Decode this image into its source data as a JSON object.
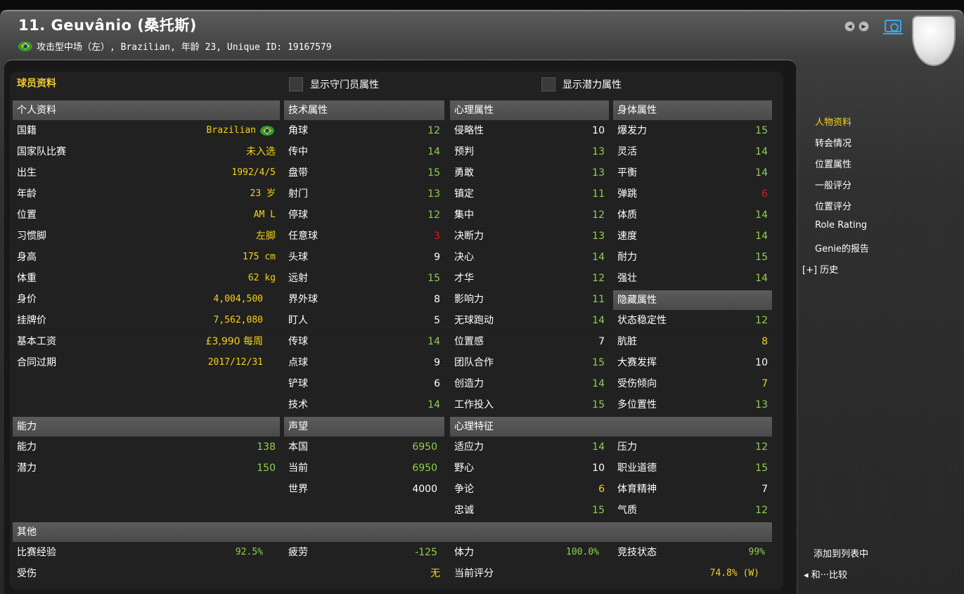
{
  "header": {
    "title": "11. Geuvânio (桑托斯)",
    "subtitle": "攻击型中场（左）, Brazilian, 年龄 23, Unique ID: 19167579"
  },
  "checkboxes": {
    "show_gk": "显示守门员属性",
    "show_potential": "显示潜力属性"
  },
  "panel_title": "球员资料",
  "personal": {
    "heading": "个人资料",
    "rows": [
      {
        "label": "国籍",
        "value": "Brazilian"
      },
      {
        "label": "国家队比赛",
        "value": "未入选"
      },
      {
        "label": "出生",
        "value": "1992/4/5"
      },
      {
        "label": "年龄",
        "value": "23 岁"
      },
      {
        "label": "位置",
        "value": "AM L"
      },
      {
        "label": "习惯脚",
        "value": "左脚"
      },
      {
        "label": "身高",
        "value": "175 cm"
      },
      {
        "label": "体重",
        "value": "62 kg"
      },
      {
        "label": "身价",
        "value": "4,004,500"
      },
      {
        "label": "挂牌价",
        "value": "7,562,080"
      },
      {
        "label": "基本工资",
        "value": "£3,990 每周"
      },
      {
        "label": "合同过期",
        "value": "2017/12/31"
      }
    ]
  },
  "technical": {
    "heading": "技术属性",
    "rows": [
      {
        "label": "角球",
        "value": "12"
      },
      {
        "label": "传中",
        "value": "14"
      },
      {
        "label": "盘带",
        "value": "15"
      },
      {
        "label": "射门",
        "value": "13"
      },
      {
        "label": "停球",
        "value": "12"
      },
      {
        "label": "任意球",
        "value": "3"
      },
      {
        "label": "头球",
        "value": "9"
      },
      {
        "label": "远射",
        "value": "15"
      },
      {
        "label": "界外球",
        "value": "8"
      },
      {
        "label": "盯人",
        "value": "5"
      },
      {
        "label": "传球",
        "value": "14"
      },
      {
        "label": "点球",
        "value": "9"
      },
      {
        "label": "铲球",
        "value": "6"
      },
      {
        "label": "技术",
        "value": "14"
      }
    ]
  },
  "mental": {
    "heading": "心理属性",
    "rows": [
      {
        "label": "侵略性",
        "value": "10"
      },
      {
        "label": "预判",
        "value": "13"
      },
      {
        "label": "勇敢",
        "value": "13"
      },
      {
        "label": "镇定",
        "value": "11"
      },
      {
        "label": "集中",
        "value": "12"
      },
      {
        "label": "决断力",
        "value": "13"
      },
      {
        "label": "决心",
        "value": "14"
      },
      {
        "label": "才华",
        "value": "12"
      },
      {
        "label": "影响力",
        "value": "11"
      },
      {
        "label": "无球跑动",
        "value": "14"
      },
      {
        "label": "位置感",
        "value": "7"
      },
      {
        "label": "团队合作",
        "value": "15"
      },
      {
        "label": "创造力",
        "value": "14"
      },
      {
        "label": "工作投入",
        "value": "15"
      }
    ]
  },
  "physical": {
    "heading": "身体属性",
    "rows": [
      {
        "label": "爆发力",
        "value": "15"
      },
      {
        "label": "灵活",
        "value": "14"
      },
      {
        "label": "平衡",
        "value": "14"
      },
      {
        "label": "弹跳",
        "value": "6"
      },
      {
        "label": "体质",
        "value": "14"
      },
      {
        "label": "速度",
        "value": "14"
      },
      {
        "label": "耐力",
        "value": "15"
      },
      {
        "label": "强壮",
        "value": "14"
      }
    ]
  },
  "hidden": {
    "heading": "隐藏属性",
    "rows": [
      {
        "label": "状态稳定性",
        "value": "12"
      },
      {
        "label": "肮脏",
        "value": "8"
      },
      {
        "label": "大赛发挥",
        "value": "10"
      },
      {
        "label": "受伤倾向",
        "value": "7"
      },
      {
        "label": "多位置性",
        "value": "13"
      }
    ]
  },
  "ability": {
    "heading": "能力",
    "rows": [
      {
        "label": "能力",
        "value": "138"
      },
      {
        "label": "潜力",
        "value": "150"
      }
    ]
  },
  "reputation": {
    "heading": "声望",
    "rows": [
      {
        "label": "本国",
        "value": "6950"
      },
      {
        "label": "当前",
        "value": "6950"
      },
      {
        "label": "世界",
        "value": "4000"
      }
    ]
  },
  "traits": {
    "heading": "心理特征",
    "left": [
      {
        "label": "适应力",
        "value": "14"
      },
      {
        "label": "野心",
        "value": "10"
      },
      {
        "label": "争论",
        "value": "6"
      },
      {
        "label": "忠诚",
        "value": "15"
      }
    ],
    "right": [
      {
        "label": "压力",
        "value": "12"
      },
      {
        "label": "职业道德",
        "value": "15"
      },
      {
        "label": "体育精神",
        "value": "7"
      },
      {
        "label": "气质",
        "value": "12"
      }
    ]
  },
  "other": {
    "heading": "其他",
    "match_exp_label": "比赛经验",
    "match_exp_value": "92.5%",
    "injury_label": "受伤",
    "injury_value": "无",
    "fatigue_label": "疲劳",
    "fatigue_value": "-125",
    "stamina_label": "体力",
    "stamina_value": "100.0%",
    "rating_label": "当前评分",
    "rating_value": "74.8% (W)",
    "form_label": "竞技状态",
    "form_value": "99%"
  },
  "sidebar": {
    "items": [
      "人物资料",
      "转会情况",
      "位置属性",
      "一般评分",
      "位置评分",
      "Role Rating",
      "Genie的报告",
      "[+] 历史"
    ],
    "add_to_list": "添加到列表中",
    "compare": "◂ 和···比较"
  }
}
